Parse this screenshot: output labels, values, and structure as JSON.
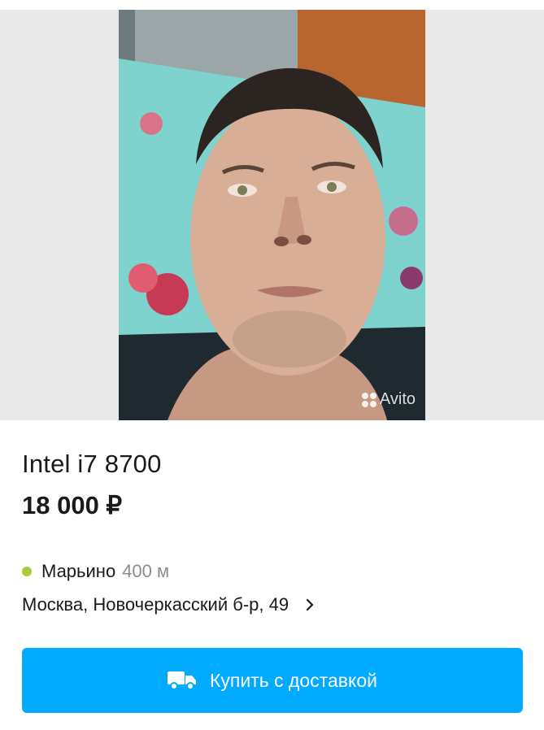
{
  "listing": {
    "photo_watermark": "Avito",
    "title": "Intel i7 8700",
    "price": "18 000 ₽",
    "metro_station": "Марьино",
    "metro_distance": "400 м",
    "address": "Москва, Новочеркасский б-р, 49"
  },
  "actions": {
    "buy_delivery_label": "Купить с доставкой"
  },
  "icons": {
    "metro": "metro-dot-icon",
    "address": "chevron-right-icon",
    "delivery": "truck-icon",
    "watermark": "avito-logo-icon"
  },
  "colors": {
    "button_bg": "#00aaff",
    "metro_line": "#a7cc3b",
    "text_primary": "#1a1a1a",
    "text_secondary": "#8c8c8c"
  }
}
